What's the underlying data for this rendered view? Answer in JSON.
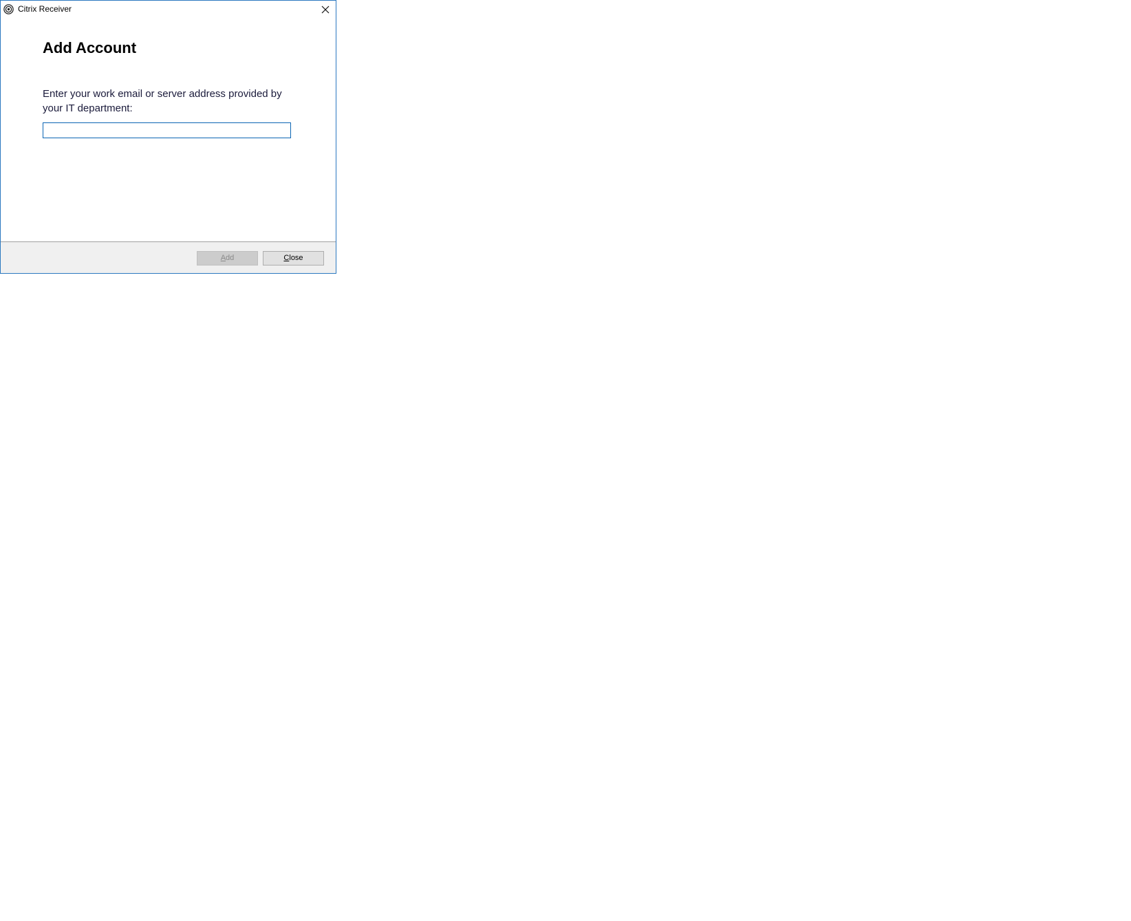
{
  "window": {
    "title": "Citrix Receiver",
    "icon": "citrix-receiver-icon",
    "close_icon": "close-icon"
  },
  "dialog": {
    "heading": "Add Account",
    "prompt": "Enter your work email or server address provided by your IT department:",
    "input": {
      "value": "",
      "placeholder": ""
    }
  },
  "buttons": {
    "add": {
      "accel": "A",
      "rest": "dd",
      "enabled": false
    },
    "close": {
      "accel": "C",
      "rest": "lose",
      "enabled": true
    }
  },
  "colors": {
    "window_border": "#2b78c0",
    "input_border": "#0a64b4",
    "footer_bg": "#f0f0f0"
  }
}
